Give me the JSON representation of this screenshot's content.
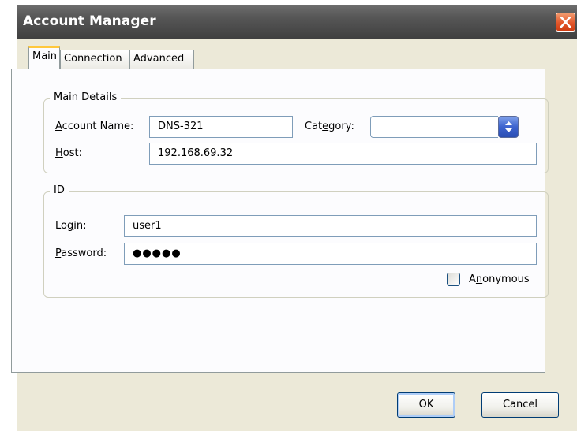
{
  "window": {
    "title": "Account Manager"
  },
  "tabs": [
    {
      "label": "Main",
      "active": true
    },
    {
      "label": "Connection",
      "active": false
    },
    {
      "label": "Advanced",
      "active": false
    }
  ],
  "main_details": {
    "legend": "Main Details",
    "account_name_label_mnemonic": "A",
    "account_name_label_rest": "ccount Name:",
    "account_name_value": "DNS-321",
    "category_label_pre": "Cat",
    "category_label_mnemonic": "e",
    "category_label_post": "gory:",
    "category_value": "",
    "host_label_mnemonic": "H",
    "host_label_rest": "ost:",
    "host_value": "192.168.69.32"
  },
  "id_group": {
    "legend": "ID",
    "login_label_pre": "Lo",
    "login_label_mnemonic": "g",
    "login_label_post": "in:",
    "login_value": "user1",
    "password_label_mnemonic": "P",
    "password_label_rest": "assword:",
    "password_value": "●●●●●",
    "anonymous_label_pre": "A",
    "anonymous_label_mnemonic": "n",
    "anonymous_label_post": "onymous",
    "anonymous_checked": false
  },
  "buttons": {
    "ok": "OK",
    "cancel": "Cancel"
  },
  "colors": {
    "titlebar": "#4a4a4a",
    "close_button": "#e05a2c",
    "tab_highlight": "#ffc83c",
    "spin_button": "#3e64cf"
  },
  "icons": {
    "close": "close-icon",
    "spinner": "spin-arrows-icon"
  }
}
